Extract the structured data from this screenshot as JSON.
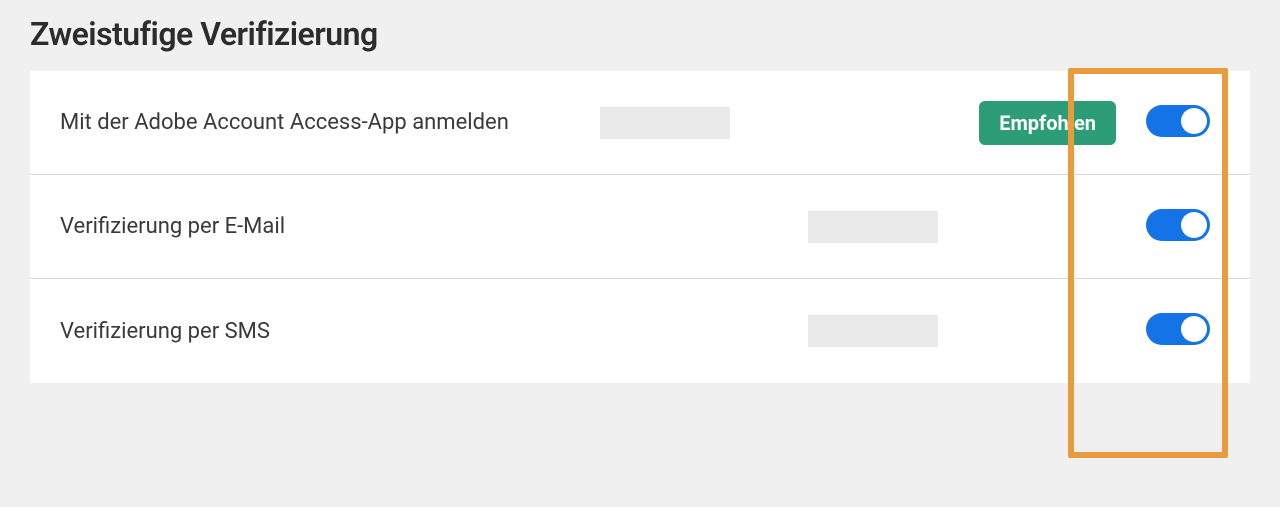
{
  "title": "Zweistufige Verifizierung",
  "recommended_label": "Empfohlen",
  "settings": {
    "app": {
      "label": "Mit der Adobe Account Access-App anmelden",
      "recommended": true,
      "enabled": true
    },
    "email": {
      "label": "Verifizierung per E-Mail",
      "recommended": false,
      "enabled": true
    },
    "sms": {
      "label": "Verifizierung per SMS",
      "recommended": false,
      "enabled": true
    }
  },
  "colors": {
    "toggle_on": "#1473e6",
    "recommended_badge": "#2d9d78",
    "highlight_border": "#e89c3c"
  }
}
